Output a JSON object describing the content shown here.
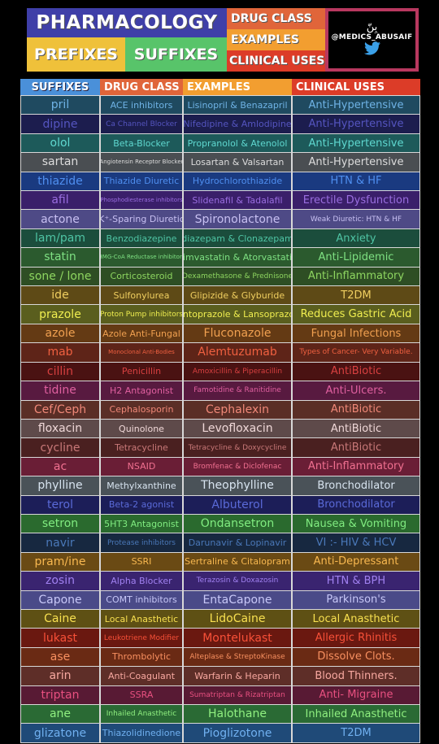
{
  "header": {
    "title": "PHARMACOLOGY",
    "prefixes": "PREFIXES",
    "suffixes": "SUFFIXES",
    "drug_class": "DRUG CLASS",
    "examples": "EXAMPLES",
    "clinical_uses": "CLINICAL USES",
    "logo_arabic": "بِنّ",
    "logo_handle": "@MEDICS_ABUSAIF",
    "logo_icon": "twitter-bird-icon"
  },
  "columns": [
    "SUFFIXES",
    "DRUG CLASS",
    "EXAMPLES",
    "CLINICAL USES"
  ],
  "rows": [
    {
      "suffix": "pril",
      "drug_class": "ACE inhibitors",
      "examples": "Lisinopril & Benazapril",
      "use": "Anti-Hypertensive",
      "bg": "#1f4a60",
      "fg": "#6fb3e6"
    },
    {
      "suffix": "dipine",
      "drug_class": "Ca Channel Blocker",
      "examples": "Nifedipine & Amlodipine",
      "use": "Anti-Hypertensive",
      "bg": "#1c1d4e",
      "fg": "#5555c0"
    },
    {
      "suffix": "olol",
      "drug_class": "Beta-Blocker",
      "examples": "Propranolol & Atenolol",
      "use": "Anti-Hypertensive",
      "bg": "#1d5a5a",
      "fg": "#5fd8d0"
    },
    {
      "suffix": "sartan",
      "drug_class": "Angiotensin Receptor Blocker",
      "examples": "Losartan & Valsartan",
      "use": "Anti-Hypertensive",
      "bg": "#4a4e52",
      "fg": "#dcdcdc"
    },
    {
      "suffix": "thiazide",
      "drug_class": "Thiazide Diuretic",
      "examples": "Hydrochlorothiazide",
      "use": "HTN & HF",
      "bg": "#1a3a80",
      "fg": "#4f8ff0"
    },
    {
      "suffix": "afil",
      "drug_class": "Phosphodiesterase inhibitors",
      "examples": "Slidenafil & Tadalafil",
      "use": "Erectile Dysfunction",
      "bg": "#3a1f6a",
      "fg": "#9a6ee0"
    },
    {
      "suffix": "actone",
      "drug_class": "K⁺-Sparing Diuretic",
      "examples": "Spironolactone",
      "use": "Weak Diuretic: HTN & HF",
      "bg": "#4e4a86",
      "fg": "#c8c0f2"
    },
    {
      "suffix": "lam/pam",
      "drug_class": "Benzodiazepine",
      "examples": "diazepam & Clonazepam",
      "use": "Anxiety",
      "bg": "#1b4d3c",
      "fg": "#4fc4a4"
    },
    {
      "suffix": "statin",
      "drug_class": "HMG-CoA Reductase inhibitors",
      "examples": "Simvastatin & Atorvastatin",
      "use": "Anti-Lipidemic",
      "bg": "#2b5a2e",
      "fg": "#7ee082"
    },
    {
      "suffix": "sone / lone",
      "drug_class": "Corticosteroid",
      "examples": "Dexamethasone & Prednisone",
      "use": "Anti-Inflammatory",
      "bg": "#2e4e24",
      "fg": "#8ed660"
    },
    {
      "suffix": "ide",
      "drug_class": "Sulfonylurea",
      "examples": "Glipizide & Glyburide",
      "use": "T2DM",
      "bg": "#5e4a16",
      "fg": "#f0cf60"
    },
    {
      "suffix": "prazole",
      "drug_class": "Proton Pump inhibitors",
      "examples": "Pantoprazole & Lansoprazole",
      "use": "Reduces Gastric Acid",
      "bg": "#5a5e1e",
      "fg": "#f0ee50"
    },
    {
      "suffix": "azole",
      "drug_class": "Azole Anti-Fungal",
      "examples": "Fluconazole",
      "use": "Fungal Infections",
      "bg": "#643a14",
      "fg": "#f0a050"
    },
    {
      "suffix": "mab",
      "drug_class": "Monoclonal Anti-Bodies",
      "examples": "Alemtuzumab",
      "use": "Types of Cancer- Very Variable.",
      "bg": "#5e2418",
      "fg": "#f06040"
    },
    {
      "suffix": "cillin",
      "drug_class": "Penicillin",
      "examples": "Amoxicillin & Piperacillin",
      "use": "AntiBiotic",
      "bg": "#4a1212",
      "fg": "#d84040"
    },
    {
      "suffix": "tidine",
      "drug_class": "H2 Antagonist",
      "examples": "Famotidine & Ranitidine",
      "use": "Anti-Ulcers.",
      "bg": "#581a40",
      "fg": "#e060a0"
    },
    {
      "suffix": "Cef/Ceph",
      "drug_class": "Cephalosporin",
      "examples": "Cephalexin",
      "use": "AntiBiotic",
      "bg": "#5a2e26",
      "fg": "#f08878"
    },
    {
      "suffix": "floxacin",
      "drug_class": "Quinolone",
      "examples": "Levofloxacin",
      "use": "AntiBiotic",
      "bg": "#5e4a4a",
      "fg": "#f0d8d8"
    },
    {
      "suffix": "cycline",
      "drug_class": "Tetracycline",
      "examples": "Tetracycline & Doxycycline",
      "use": "AntiBiotic",
      "bg": "#4a2020",
      "fg": "#c87878"
    },
    {
      "suffix": "ac",
      "drug_class": "NSAID",
      "examples": "Bromfenac & Diclofenac",
      "use": "Anti-Inflammatory",
      "bg": "#6a1e36",
      "fg": "#f07090"
    },
    {
      "suffix": "phylline",
      "drug_class": "Methylxanthine",
      "examples": "Theophylline",
      "use": "Bronchodilator",
      "bg": "#4a5258",
      "fg": "#d8e4f0"
    },
    {
      "suffix": "terol",
      "drug_class": "Beta-2 agonist",
      "examples": "Albuterol",
      "use": "Bronchodilator",
      "bg": "#1c1e58",
      "fg": "#5a6ad8"
    },
    {
      "suffix": "setron",
      "drug_class": "5HT3 Antagonist",
      "examples": "Ondansetron",
      "use": "Nausea & Vomiting",
      "bg": "#2a6a2e",
      "fg": "#80ec80"
    },
    {
      "suffix": "navir",
      "drug_class": "Protease inhibitors",
      "examples": "Darunavir & Lopinavir",
      "use": "VI :- HIV & HCV",
      "bg": "#172840",
      "fg": "#4a78b8"
    },
    {
      "suffix": "pram/ine",
      "drug_class": "SSRI",
      "examples": "Sertraline & Citalopram",
      "use": "Anti-Depressant",
      "bg": "#6a4a14",
      "fg": "#f8b850"
    },
    {
      "suffix": "zosin",
      "drug_class": "Alpha Blocker",
      "examples": "Terazosin & Doxazosin",
      "use": "HTN & BPH",
      "bg": "#3a2470",
      "fg": "#a080f0"
    },
    {
      "suffix": "Capone",
      "drug_class": "COMT inhibitors",
      "examples": "EntaCapone",
      "use": "Parkinson's",
      "bg": "#4a4a88",
      "fg": "#c8c8f8"
    },
    {
      "suffix": "Caine",
      "drug_class": "Local Anasthetic",
      "examples": "LidoCaine",
      "use": "Local Anasthetic",
      "bg": "#5e5014",
      "fg": "#f8e050"
    },
    {
      "suffix": "lukast",
      "drug_class": "Leukotriene Modifier",
      "examples": "Montelukast",
      "use": "Allergic Rhinitis",
      "bg": "#6a1810",
      "fg": "#f85038"
    },
    {
      "suffix": "ase",
      "drug_class": "Thrombolytic",
      "examples": "Alteplase & StreptoKinase",
      "use": "Dissolve Clots.",
      "bg": "#6a2a14",
      "fg": "#f89060"
    },
    {
      "suffix": "arin",
      "drug_class": "Anti-Coagulant",
      "examples": "Warfarin & Heparin",
      "use": "Blood Thinners.",
      "bg": "#5e2e28",
      "fg": "#f8a8a0"
    },
    {
      "suffix": "triptan",
      "drug_class": "SSRA",
      "examples": "Sumatriptan & Rizatriptan",
      "use": "Anti- Migraine",
      "bg": "#581a34",
      "fg": "#e85080"
    },
    {
      "suffix": "ane",
      "drug_class": "Inhailed Anasthetic",
      "examples": "Halothane",
      "use": "Inhailed Anasthetic",
      "bg": "#2a6a34",
      "fg": "#90f080"
    },
    {
      "suffix": "glizatone",
      "drug_class": "Thiazolidinedione",
      "examples": "Pioglizotone",
      "use": "T2DM",
      "bg": "#1f4a78",
      "fg": "#70b0f0"
    }
  ]
}
